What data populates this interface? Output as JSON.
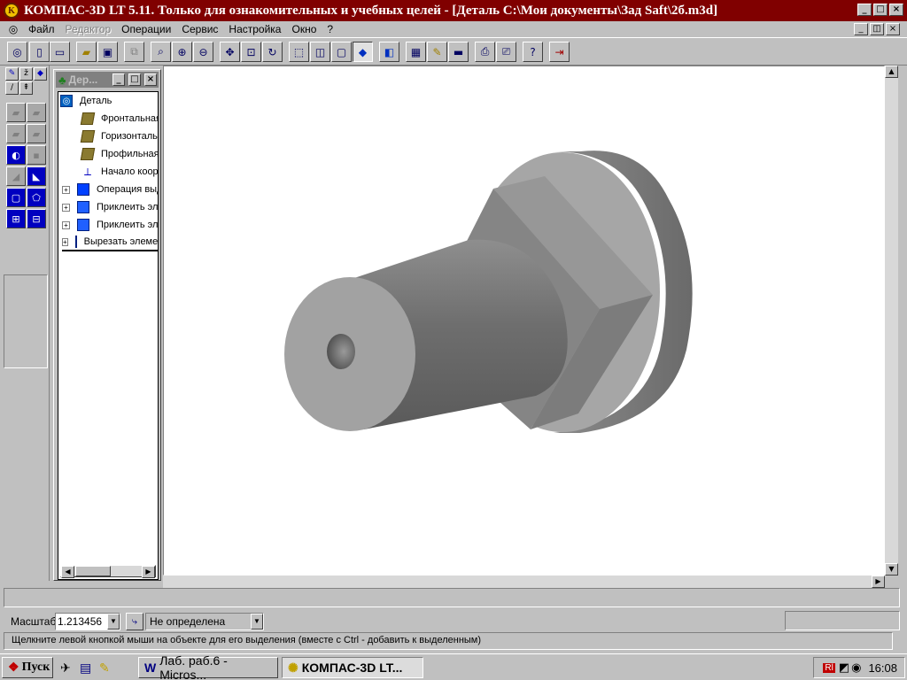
{
  "window": {
    "title": "КОМПАС-3D LT 5.11. Только для ознакомительных и учебных целей - [Деталь C:\\Мои документы\\Зад Saft\\2б.m3d]",
    "caption_buttons": [
      "_",
      "□",
      "×"
    ]
  },
  "menu": {
    "items": [
      {
        "label": "Файл",
        "enabled": true
      },
      {
        "label": "Редактор",
        "enabled": false
      },
      {
        "label": "Операции",
        "enabled": true
      },
      {
        "label": "Сервис",
        "enabled": true
      },
      {
        "label": "Настройка",
        "enabled": true
      },
      {
        "label": "Окно",
        "enabled": true
      },
      {
        "label": "?",
        "enabled": true
      }
    ],
    "mdi_buttons": [
      "_",
      "◫",
      "×"
    ]
  },
  "toolbar": {
    "icons": [
      "kompas-logo-icon",
      "new-doc-icon",
      "new-part-icon",
      "open-icon",
      "save-icon",
      "preview-disabled-icon",
      "zoom-window-icon",
      "zoom-in-icon",
      "zoom-out-icon",
      "pan-icon",
      "zoom-all-icon",
      "rotate-icon",
      "wireframe-icon",
      "hidden-lines-icon",
      "visible-edges-icon",
      "shaded-icon",
      "perspective-icon",
      "measure-icon",
      "model-properties-icon",
      "mass-icon",
      "print-preview-icon",
      "print-icon",
      "help-icon",
      "exit-icon"
    ]
  },
  "tree": {
    "caption": "Дер...",
    "root": "Деталь",
    "items": [
      {
        "label": "Фронтальная плоскость",
        "type": "plane",
        "expandable": false
      },
      {
        "label": "Горизонтальная плоскость",
        "type": "plane",
        "expandable": false
      },
      {
        "label": "Профильная плоскость",
        "type": "plane",
        "expandable": false
      },
      {
        "label": "Начало координат",
        "type": "origin",
        "expandable": false
      },
      {
        "label": "Операция выдавливания",
        "type": "extrude",
        "expandable": true
      },
      {
        "label": "Приклеить элемент",
        "type": "boss",
        "expandable": true
      },
      {
        "label": "Приклеить элемент",
        "type": "boss",
        "expandable": true
      },
      {
        "label": "Вырезать элемент",
        "type": "cut",
        "expandable": true
      }
    ]
  },
  "props": {
    "scale_label": "Масштаб",
    "scale_value": "1.213456",
    "orientation_value": "Не определена"
  },
  "hint": "Щелкните левой кнопкой мыши на объекте для его выделения (вместе с Ctrl - добавить к выделенным)",
  "taskbar": {
    "start_label": "Пуск",
    "tasks": [
      {
        "label": "Лаб. раб.6 - Micros...",
        "active": false
      },
      {
        "label": "КОМПАС-3D LT...",
        "active": true
      }
    ],
    "clock": "16:08",
    "lang": "Rl"
  },
  "colors": {
    "title_bg": "#800000",
    "chrome": "#c0c0c0",
    "viewport": "#ffffff"
  }
}
